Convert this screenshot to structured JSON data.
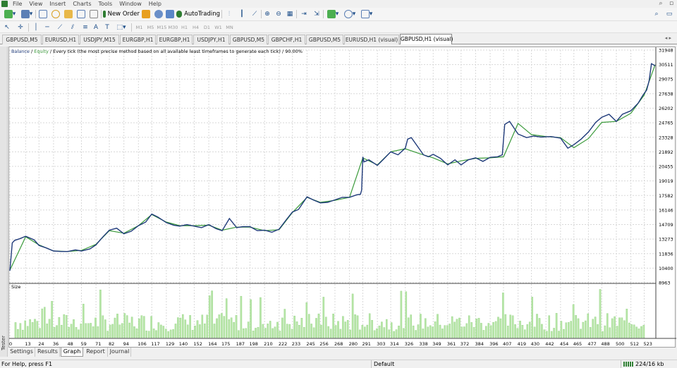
{
  "menu": [
    "File",
    "View",
    "Insert",
    "Charts",
    "Tools",
    "Window",
    "Help"
  ],
  "toolbar": {
    "new_order_label": "New Order",
    "autotrading_label": "AutoTrading",
    "timeframes": [
      "M1",
      "M5",
      "M15",
      "M30",
      "H1",
      "H4",
      "D1",
      "W1",
      "MN"
    ]
  },
  "chart_tabs": [
    {
      "label": "GBPUSD,M5",
      "active": false
    },
    {
      "label": "EURUSD,H1",
      "active": false
    },
    {
      "label": "USDJPY,M15",
      "active": false
    },
    {
      "label": "EURGBP,H1",
      "active": false
    },
    {
      "label": "EURGBP,H1",
      "active": false
    },
    {
      "label": "USDJPY,H1",
      "active": false
    },
    {
      "label": "GBPUSD,M5",
      "active": false
    },
    {
      "label": "GBPCHF,H1",
      "active": false
    },
    {
      "label": "GBPUSD,M5",
      "active": false
    },
    {
      "label": "EURUSD,H1 (visual)",
      "active": false
    },
    {
      "label": "GBPUSD,H1 (visual)",
      "active": true
    }
  ],
  "chart_header": {
    "balance": "Balance",
    "sep1": " / ",
    "equity": "Equity",
    "rest": " / Every tick (the most precise method based on all available least timeframes to generate each tick) / 90.00%"
  },
  "size_label": "Size",
  "tester_label": "Tester",
  "colors": {
    "balance_line": "#1f3a7a",
    "equity_line": "#3a9a3a",
    "volume_bar": "#b8e6a8",
    "volume_bar_edge": "#7cc96a",
    "grid": "#d8d8d8"
  },
  "chart_data": {
    "type": "line",
    "title": "",
    "xlabel": "",
    "ylabel": "",
    "ylim": [
      8963,
      31948
    ],
    "xlim": [
      0,
      532
    ],
    "y_ticks": [
      31948,
      30511,
      29075,
      27638,
      26202,
      24765,
      23328,
      21892,
      20455,
      19019,
      17582,
      16146,
      14709,
      13273,
      11836,
      10400,
      8963
    ],
    "x_ticks": [
      0,
      13,
      24,
      36,
      48,
      59,
      71,
      82,
      94,
      106,
      117,
      129,
      140,
      152,
      164,
      175,
      187,
      198,
      210,
      222,
      233,
      245,
      256,
      268,
      280,
      291,
      303,
      314,
      326,
      338,
      349,
      361,
      372,
      384,
      396,
      407,
      419,
      430,
      442,
      454,
      465,
      477,
      488,
      500,
      512,
      523
    ],
    "series": [
      {
        "name": "Balance",
        "x": [
          0,
          2,
          4,
          8,
          13,
          20,
          24,
          30,
          36,
          42,
          48,
          54,
          59,
          66,
          71,
          76,
          82,
          88,
          94,
          100,
          106,
          112,
          117,
          122,
          129,
          135,
          140,
          146,
          152,
          158,
          164,
          170,
          175,
          181,
          187,
          192,
          198,
          204,
          210,
          216,
          222,
          228,
          233,
          238,
          245,
          250,
          256,
          262,
          268,
          274,
          280,
          286,
          289,
          290,
          291,
          292,
          296,
          303,
          308,
          314,
          320,
          326,
          328,
          331,
          336,
          341,
          345,
          349,
          355,
          361,
          367,
          372,
          378,
          384,
          390,
          396,
          402,
          406,
          408,
          412,
          419,
          426,
          432,
          438,
          446,
          454,
          460,
          465,
          471,
          477,
          483,
          488,
          494,
          500,
          505,
          512,
          518,
          522,
          525,
          527,
          529,
          532
        ],
        "values": [
          10150,
          12900,
          13150,
          13300,
          13550,
          13200,
          12650,
          12400,
          12100,
          12050,
          12050,
          12200,
          12100,
          12300,
          12700,
          13400,
          14150,
          14350,
          13800,
          14050,
          14600,
          14950,
          15750,
          15450,
          14900,
          14650,
          14550,
          14700,
          14550,
          14400,
          14700,
          14300,
          14100,
          15300,
          14400,
          14500,
          14500,
          14100,
          14150,
          13950,
          14250,
          15200,
          15950,
          16200,
          17450,
          17150,
          16850,
          16900,
          17150,
          17400,
          17400,
          17650,
          17700,
          18100,
          21400,
          20900,
          21100,
          20550,
          21150,
          21900,
          21600,
          22250,
          23150,
          23300,
          22450,
          21600,
          21400,
          21650,
          21250,
          20600,
          21100,
          20600,
          21100,
          21300,
          20950,
          21350,
          21400,
          21600,
          24600,
          24900,
          23650,
          23300,
          23450,
          23350,
          23400,
          23250,
          22250,
          22600,
          23150,
          23850,
          24800,
          25300,
          25600,
          24900,
          25600,
          25950,
          26700,
          27500,
          28000,
          28900,
          30600,
          30400
        ]
      },
      {
        "name": "Equity",
        "x": [
          0,
          13,
          24,
          36,
          48,
          59,
          71,
          82,
          94,
          106,
          117,
          129,
          140,
          152,
          164,
          175,
          187,
          198,
          210,
          222,
          233,
          245,
          256,
          268,
          280,
          291,
          303,
          314,
          326,
          338,
          349,
          361,
          372,
          384,
          396,
          407,
          419,
          430,
          442,
          454,
          465,
          477,
          488,
          500,
          512,
          523,
          532
        ],
        "values": [
          10200,
          13500,
          12700,
          12100,
          12050,
          12150,
          12750,
          14100,
          13850,
          14600,
          15700,
          14950,
          14600,
          14600,
          14650,
          14150,
          14450,
          14450,
          14100,
          14200,
          15900,
          17400,
          16900,
          17100,
          17400,
          21300,
          20600,
          21900,
          22200,
          21700,
          21300,
          20700,
          21000,
          21250,
          21300,
          21400,
          24700,
          23600,
          23400,
          23300,
          22300,
          23200,
          24800,
          24900,
          25700,
          27500,
          30500
        ]
      }
    ],
    "size_series": {
      "name": "Size"
    }
  },
  "bottom_tabs": [
    {
      "label": "Settings",
      "active": false
    },
    {
      "label": "Results",
      "active": false
    },
    {
      "label": "Graph",
      "active": true
    },
    {
      "label": "Report",
      "active": false
    },
    {
      "label": "Journal",
      "active": false
    }
  ],
  "status": {
    "help": "For Help, press F1",
    "profile": "Default",
    "traffic": "224/16 kb"
  }
}
